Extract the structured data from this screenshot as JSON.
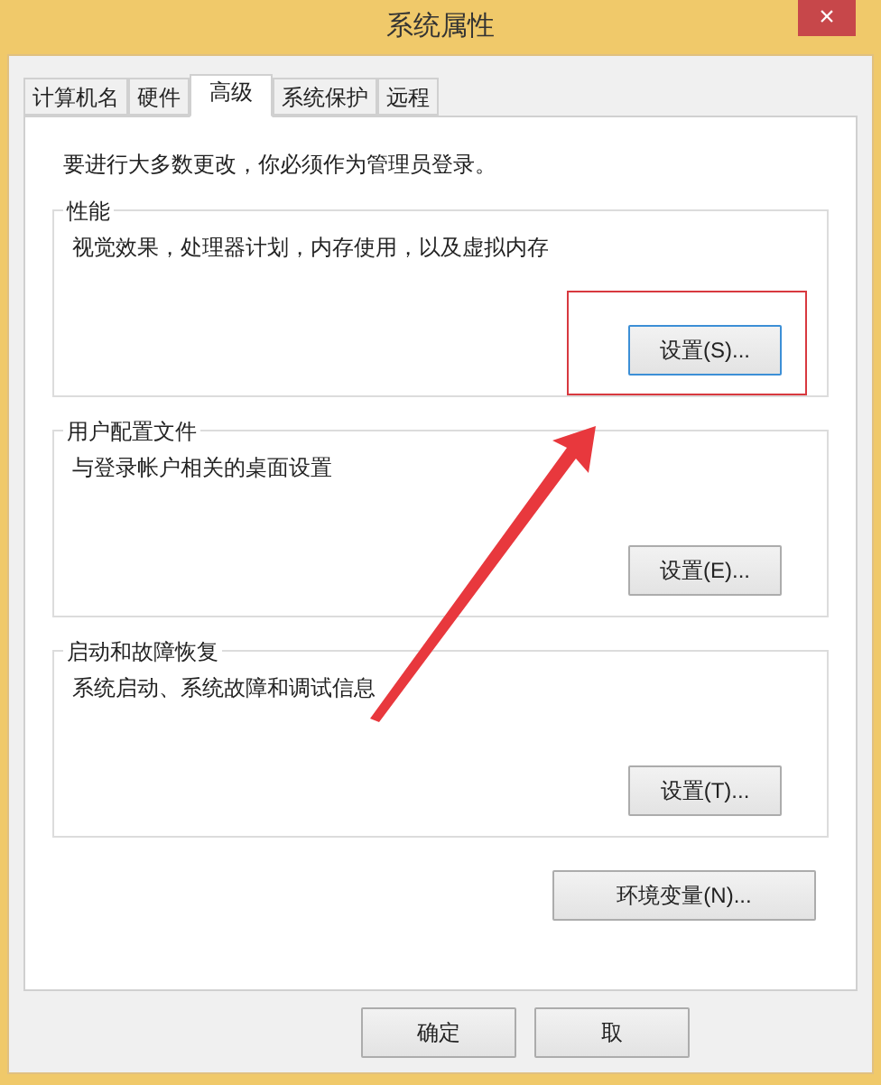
{
  "window": {
    "title": "系统属性",
    "close": "×"
  },
  "tabs": [
    {
      "label": "计算机名",
      "selected": false
    },
    {
      "label": "硬件",
      "selected": false
    },
    {
      "label": "高级",
      "selected": true
    },
    {
      "label": "系统保护",
      "selected": false
    },
    {
      "label": "远程",
      "selected": false
    }
  ],
  "notice": "要进行大多数更改，你必须作为管理员登录。",
  "groups": [
    {
      "title": "性能",
      "description": "视觉效果，处理器计划，内存使用，以及虚拟内存",
      "button": "设置(S)...",
      "focused": true,
      "highlighted": true
    },
    {
      "title": "用户配置文件",
      "description": "与登录帐户相关的桌面设置",
      "button": "设置(E)...",
      "focused": false,
      "highlighted": false
    },
    {
      "title": "启动和故障恢复",
      "description": "系统启动、系统故障和调试信息",
      "button": "设置(T)...",
      "focused": false,
      "highlighted": false
    }
  ],
  "environment_button": "环境变量(N)...",
  "footer_buttons": [
    "确定",
    "取"
  ]
}
